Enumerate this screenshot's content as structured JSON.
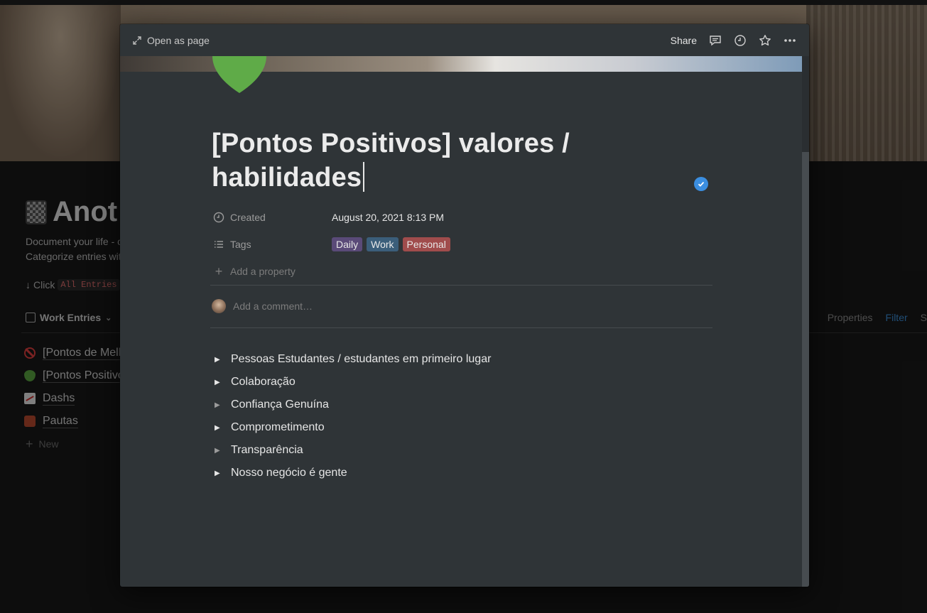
{
  "background_page": {
    "title": "Anot",
    "description_lines": [
      "Document your life - c",
      "Categorize entries wit"
    ],
    "click_prefix": "Click",
    "click_code": "All Entries",
    "view_name": "Work Entries",
    "toolbar": {
      "properties": "Properties",
      "filter": "Filter",
      "cut": "S"
    },
    "items": [
      {
        "label": "[Pontos de Melh",
        "icon": "no-entry-icon"
      },
      {
        "label": "[Pontos Positivo",
        "icon": "green-heart-icon"
      },
      {
        "label": "Dashs",
        "icon": "chart-increasing-icon"
      },
      {
        "label": "Pautas",
        "icon": "briefcase-icon"
      }
    ],
    "new_label": "New"
  },
  "modal": {
    "open_as_page": "Open as page",
    "share": "Share",
    "title_line1": "[Pontos Positivos] valores /",
    "title_line2": "habilidades",
    "page_icon": "green-heart-icon",
    "properties": {
      "created_label": "Created",
      "created_value": "August 20, 2021 8:13 PM",
      "tags_label": "Tags",
      "tags": [
        {
          "label": "Daily",
          "color": "#5a4a78"
        },
        {
          "label": "Work",
          "color": "#3b5e7a"
        },
        {
          "label": "Personal",
          "color": "#a04c4c"
        }
      ],
      "add_property": "Add a property"
    },
    "comment_placeholder": "Add a comment…",
    "toggles": [
      "Pessoas Estudantes / estudantes em primeiro lugar",
      "Colaboração",
      "Confiança Genuína",
      "Comprometimento",
      "Transparência",
      "Nosso negócio é gente"
    ]
  }
}
